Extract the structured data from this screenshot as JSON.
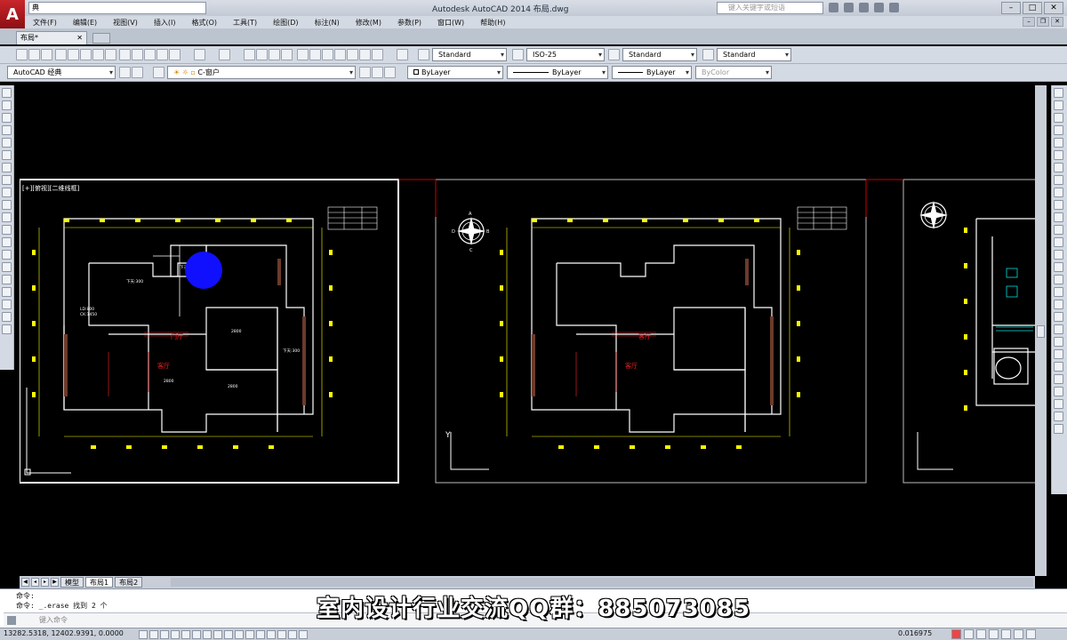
{
  "titlebar": {
    "window_title": "Autodesk AutoCAD 2014    布局.dwg",
    "quick_access_value": "典",
    "help_search_placeholder": "键入关键字或短语"
  },
  "menus": [
    "文件(F)",
    "编辑(E)",
    "视图(V)",
    "插入(I)",
    "格式(O)",
    "工具(T)",
    "绘图(D)",
    "标注(N)",
    "修改(M)",
    "参数(P)",
    "窗口(W)",
    "帮助(H)"
  ],
  "tabs": {
    "document_tab": "布局*"
  },
  "toolbar1": {
    "text_style": "Standard",
    "dim_style": "ISO-25",
    "table_style": "Standard",
    "mleader_style": "Standard"
  },
  "toolbar2": {
    "workspace": "AutoCAD 经典",
    "layer": "C-窗户",
    "color": "ByLayer",
    "linetype": "ByLayer",
    "lineweight": "ByLayer",
    "plotstyle": "ByColor"
  },
  "drawing": {
    "viewport_label": "[+][俯视][二维线框]",
    "north_labels": [
      "A",
      "B",
      "C",
      "D"
    ],
    "room_labels": [
      "门厅",
      "客厅",
      "下天:300",
      "下天:300",
      "下天:300",
      "LD:800",
      "CK:1450",
      "2800",
      "2800",
      "2800",
      "客厅",
      "客厅"
    ],
    "axis_y": "Y"
  },
  "layout_tabs": [
    "模型",
    "布局1",
    "布局2"
  ],
  "command": {
    "line1": "命令:",
    "line2": "命令: _.erase 找到 2 个",
    "prompt": "键入命令"
  },
  "overlay": "室内设计行业交流QQ群：885073085",
  "status": {
    "coords": "13282.5318, 12402.9391, 0.0000",
    "scale": "0.016975"
  },
  "colors": {
    "canvas_bg": "#000000",
    "wall": "#ffffff",
    "window": "#ffff00",
    "dimension": "#ff2020",
    "cursor_highlight": "#1010ff"
  }
}
